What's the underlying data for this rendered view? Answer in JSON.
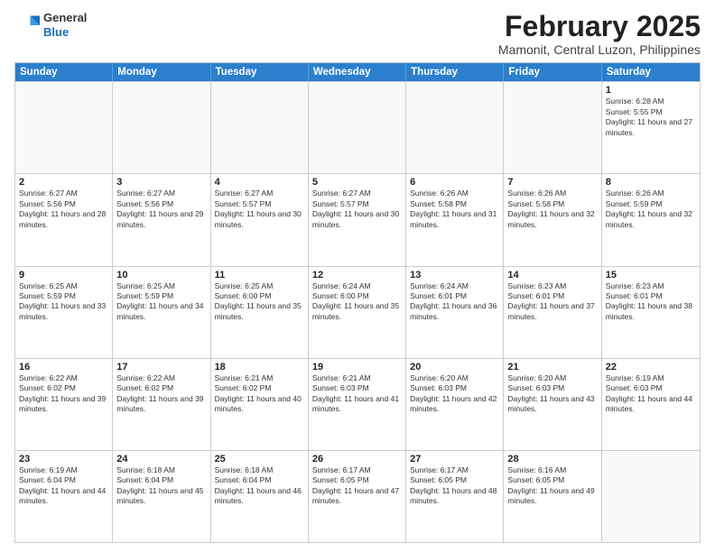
{
  "header": {
    "logo_general": "General",
    "logo_blue": "Blue",
    "title": "February 2025",
    "subtitle": "Mamonit, Central Luzon, Philippines"
  },
  "days_of_week": [
    "Sunday",
    "Monday",
    "Tuesday",
    "Wednesday",
    "Thursday",
    "Friday",
    "Saturday"
  ],
  "weeks": [
    [
      {
        "day": "",
        "info": ""
      },
      {
        "day": "",
        "info": ""
      },
      {
        "day": "",
        "info": ""
      },
      {
        "day": "",
        "info": ""
      },
      {
        "day": "",
        "info": ""
      },
      {
        "day": "",
        "info": ""
      },
      {
        "day": "1",
        "info": "Sunrise: 6:28 AM\nSunset: 5:55 PM\nDaylight: 11 hours and 27 minutes."
      }
    ],
    [
      {
        "day": "2",
        "info": "Sunrise: 6:27 AM\nSunset: 5:56 PM\nDaylight: 11 hours and 28 minutes."
      },
      {
        "day": "3",
        "info": "Sunrise: 6:27 AM\nSunset: 5:56 PM\nDaylight: 11 hours and 29 minutes."
      },
      {
        "day": "4",
        "info": "Sunrise: 6:27 AM\nSunset: 5:57 PM\nDaylight: 11 hours and 30 minutes."
      },
      {
        "day": "5",
        "info": "Sunrise: 6:27 AM\nSunset: 5:57 PM\nDaylight: 11 hours and 30 minutes."
      },
      {
        "day": "6",
        "info": "Sunrise: 6:26 AM\nSunset: 5:58 PM\nDaylight: 11 hours and 31 minutes."
      },
      {
        "day": "7",
        "info": "Sunrise: 6:26 AM\nSunset: 5:58 PM\nDaylight: 11 hours and 32 minutes."
      },
      {
        "day": "8",
        "info": "Sunrise: 6:26 AM\nSunset: 5:59 PM\nDaylight: 11 hours and 32 minutes."
      }
    ],
    [
      {
        "day": "9",
        "info": "Sunrise: 6:25 AM\nSunset: 5:59 PM\nDaylight: 11 hours and 33 minutes."
      },
      {
        "day": "10",
        "info": "Sunrise: 6:25 AM\nSunset: 5:59 PM\nDaylight: 11 hours and 34 minutes."
      },
      {
        "day": "11",
        "info": "Sunrise: 6:25 AM\nSunset: 6:00 PM\nDaylight: 11 hours and 35 minutes."
      },
      {
        "day": "12",
        "info": "Sunrise: 6:24 AM\nSunset: 6:00 PM\nDaylight: 11 hours and 35 minutes."
      },
      {
        "day": "13",
        "info": "Sunrise: 6:24 AM\nSunset: 6:01 PM\nDaylight: 11 hours and 36 minutes."
      },
      {
        "day": "14",
        "info": "Sunrise: 6:23 AM\nSunset: 6:01 PM\nDaylight: 11 hours and 37 minutes."
      },
      {
        "day": "15",
        "info": "Sunrise: 6:23 AM\nSunset: 6:01 PM\nDaylight: 11 hours and 38 minutes."
      }
    ],
    [
      {
        "day": "16",
        "info": "Sunrise: 6:22 AM\nSunset: 6:02 PM\nDaylight: 11 hours and 39 minutes."
      },
      {
        "day": "17",
        "info": "Sunrise: 6:22 AM\nSunset: 6:02 PM\nDaylight: 11 hours and 39 minutes."
      },
      {
        "day": "18",
        "info": "Sunrise: 6:21 AM\nSunset: 6:02 PM\nDaylight: 11 hours and 40 minutes."
      },
      {
        "day": "19",
        "info": "Sunrise: 6:21 AM\nSunset: 6:03 PM\nDaylight: 11 hours and 41 minutes."
      },
      {
        "day": "20",
        "info": "Sunrise: 6:20 AM\nSunset: 6:03 PM\nDaylight: 11 hours and 42 minutes."
      },
      {
        "day": "21",
        "info": "Sunrise: 6:20 AM\nSunset: 6:03 PM\nDaylight: 11 hours and 43 minutes."
      },
      {
        "day": "22",
        "info": "Sunrise: 6:19 AM\nSunset: 6:03 PM\nDaylight: 11 hours and 44 minutes."
      }
    ],
    [
      {
        "day": "23",
        "info": "Sunrise: 6:19 AM\nSunset: 6:04 PM\nDaylight: 11 hours and 44 minutes."
      },
      {
        "day": "24",
        "info": "Sunrise: 6:18 AM\nSunset: 6:04 PM\nDaylight: 11 hours and 45 minutes."
      },
      {
        "day": "25",
        "info": "Sunrise: 6:18 AM\nSunset: 6:04 PM\nDaylight: 11 hours and 46 minutes."
      },
      {
        "day": "26",
        "info": "Sunrise: 6:17 AM\nSunset: 6:05 PM\nDaylight: 11 hours and 47 minutes."
      },
      {
        "day": "27",
        "info": "Sunrise: 6:17 AM\nSunset: 6:05 PM\nDaylight: 11 hours and 48 minutes."
      },
      {
        "day": "28",
        "info": "Sunrise: 6:16 AM\nSunset: 6:05 PM\nDaylight: 11 hours and 49 minutes."
      },
      {
        "day": "",
        "info": ""
      }
    ]
  ]
}
